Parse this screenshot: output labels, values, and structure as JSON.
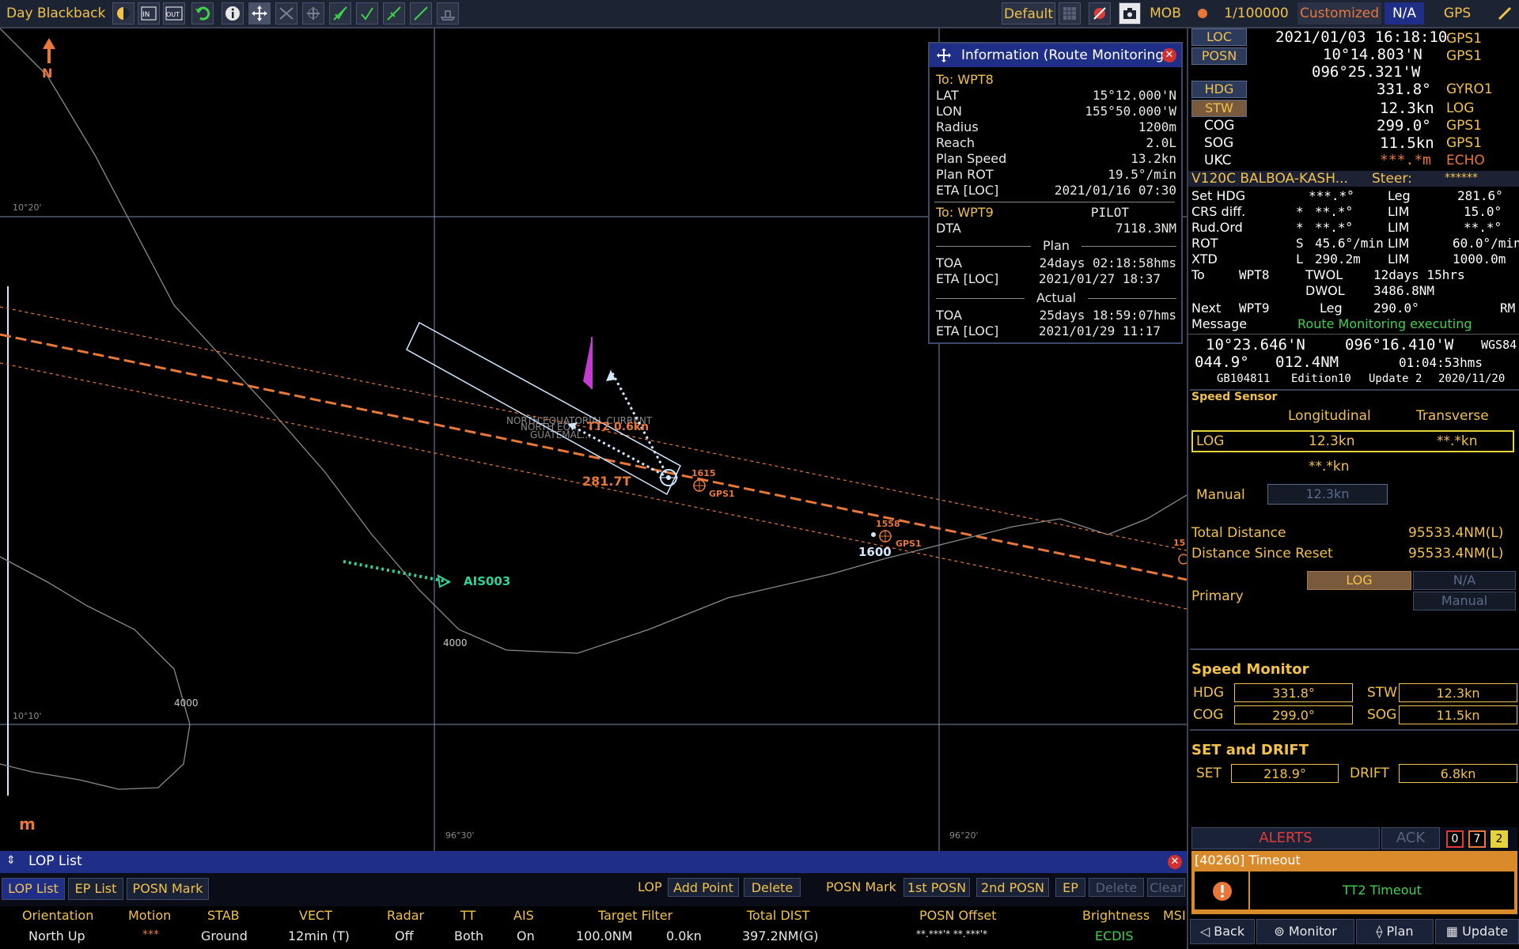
{
  "toolbar": {
    "mode": "Day Blackback",
    "default": "Default",
    "mob": "MOB",
    "scale": "1/100000",
    "customized": "Customized",
    "na": "N/A",
    "gps": "GPS"
  },
  "chart": {
    "north": "N",
    "lat_label_1": "10°20'",
    "lat_label_2": "10°10'",
    "lon_label_1": "96°30'",
    "lon_label_2": "96°20'",
    "depth_1": "4000",
    "depth_2": "4000",
    "current_text_1": "NORTH EQUATORIAL CURRENT",
    "current_text_2": "NORTH EQ...",
    "current_text_3": "GUATEMAL...",
    "tt_label": "TT2 0.6kn",
    "course_label": "281.7T",
    "time_1615": "1615",
    "gps1_a": "GPS1",
    "time_1558": "1558",
    "time_1600": "1600",
    "gps1_b": "GPS1",
    "edge_label": "15",
    "ais_label": "AIS003",
    "unit_m": "m",
    "colors": {
      "route": "#e8773a",
      "ais": "#2fd19a",
      "ownship": "#cfe8ff",
      "flag": "#c43bd4"
    }
  },
  "info": {
    "title": "Information (Route Monitoring)",
    "to_wpt8": "To: WPT8",
    "lat_label": "LAT",
    "lat": "15°12.000'N",
    "lon_label": "LON",
    "lon": "155°50.000'W",
    "radius_label": "Radius",
    "radius": "1200m",
    "reach_label": "Reach",
    "reach": "2.0L",
    "plan_speed_label": "Plan Speed",
    "plan_speed": "13.2kn",
    "plan_rot_label": "Plan ROT",
    "plan_rot": "19.5°/min",
    "eta_label": "ETA [LOC]",
    "eta": "2021/01/16 07:30",
    "to_wpt9": "To: WPT9",
    "pilot": "PILOT",
    "dta_label": "DTA",
    "dta": "7118.3NM",
    "plan_header": "Plan",
    "toa_label": "TOA",
    "toa_plan": "24days 02:18:58hms",
    "eta2_label": "ETA [LOC]",
    "eta_plan": "2021/01/27 18:37",
    "actual_header": "Actual",
    "toa2_label": "TOA",
    "toa_actual": "25days 18:59:07hms",
    "eta3_label": "ETA [LOC]",
    "eta_actual": "2021/01/29 11:17"
  },
  "nav": {
    "loc": "LOC",
    "datetime": "2021/01/03 16:18:10",
    "loc_src": "GPS1",
    "posn": "POSN",
    "lat": "10°14.803'N",
    "posn_src": "GPS1",
    "lon": "096°25.321'W",
    "hdg": "HDG",
    "hdg_val": "331.8°",
    "hdg_src": "GYRO1",
    "stw": "STW",
    "stw_val": "12.3kn",
    "stw_src": "LOG",
    "cog": "COG",
    "cog_val": "299.0°",
    "cog_src": "GPS1",
    "sog": "SOG",
    "sog_val": "11.5kn",
    "sog_src": "GPS1",
    "ukc": "UKC",
    "ukc_val": "***.*m",
    "ukc_src": "ECHO"
  },
  "route": {
    "name": "V120C BALBOA-KASH...",
    "steer_label": "Steer:",
    "steer": "******",
    "set_hdg_label": "Set HDG",
    "set_hdg": "***.*°",
    "leg_label": "Leg",
    "leg": "281.6°",
    "crs_label": "CRS diff.",
    "crs_flag": "*",
    "crs": "**.*°",
    "lim1_label": "LIM",
    "lim1": "15.0°",
    "rud_label": "Rud.Ord",
    "rud_flag": "*",
    "rud": "**.*°",
    "lim2_label": "LIM",
    "lim2": "**.*°",
    "rot_label": "ROT",
    "rot_flag": "S",
    "rot": "45.6°/min",
    "lim3_label": "LIM",
    "lim3": "60.0°/min",
    "xtd_label": "XTD",
    "xtd_flag": "L",
    "xtd": "290.2m",
    "lim4_label": "LIM",
    "lim4": "1000.0m",
    "to_label": "To",
    "to_wpt": "WPT8",
    "twol_label": "TWOL",
    "twol": "12days 15hrs",
    "dwol_label": "DWOL",
    "dwol": "3486.8NM",
    "next_label": "Next",
    "next_wpt": "WPT9",
    "leg2_label": "Leg",
    "leg2": "290.0°",
    "rm": "RM",
    "message_label": "Message",
    "message": "Route Monitoring executing",
    "cursor_lat": "10°23.646'N",
    "cursor_lon": "096°16.410'W",
    "datum": "WGS84",
    "brg": "044.9°",
    "rng": "012.4NM",
    "ttg": "01:04:53hms",
    "cell": "GB104811",
    "edition": "Edition10",
    "update": "Update 2",
    "upd_date": "2020/11/20"
  },
  "speed": {
    "sensor_title": "Speed Sensor",
    "longitudinal": "Longitudinal",
    "transverse": "Transverse",
    "log_label": "LOG",
    "log_long": "12.3kn",
    "log_trans": "**.*kn",
    "other": "**.*kn",
    "manual_label": "Manual",
    "manual_val": "12.3kn",
    "total_label": "Total Distance",
    "total": "95533.4NM(L)",
    "since_label": "Distance Since Reset",
    "since": "95533.4NM(L)",
    "primary_label": "Primary",
    "primary_log": "LOG",
    "primary_na": "N/A",
    "primary_manual": "Manual"
  },
  "monitor": {
    "title": "Speed Monitor",
    "hdg_label": "HDG",
    "hdg": "331.8°",
    "stw_label": "STW",
    "stw": "12.3kn",
    "cog_label": "COG",
    "cog": "299.0°",
    "sog_label": "SOG",
    "sog": "11.5kn"
  },
  "setdrift": {
    "title": "SET and DRIFT",
    "set_label": "SET",
    "set": "218.9°",
    "drift_label": "DRIFT",
    "drift": "6.8kn"
  },
  "alerts": {
    "title": "ALERTS",
    "ack": "ACK",
    "c0": "0",
    "c7": "7",
    "c2": "2",
    "item": "[40260] Timeout",
    "detail": "TT2 Timeout"
  },
  "bottom_nav": {
    "back": "Back",
    "monitor": "Monitor",
    "plan": "Plan",
    "update": "Update"
  },
  "lop": {
    "title": "LOP List",
    "tab_lop": "LOP List",
    "tab_ep": "EP List",
    "tab_posn": "POSN Mark",
    "lop_label": "LOP",
    "add_point": "Add Point",
    "delete": "Delete",
    "posn_mark_label": "POSN Mark",
    "first_posn": "1st POSN",
    "second_posn": "2nd POSN",
    "ep": "EP",
    "delete2": "Delete",
    "clear": "Clear",
    "status_headers": [
      "Orientation",
      "Motion",
      "STAB",
      "VECT",
      "Radar",
      "TT",
      "AIS",
      "Target Filter",
      "",
      "Total DIST",
      "POSN Offset",
      "Brightness",
      "MSI"
    ],
    "status_values": [
      "North Up",
      "***",
      "Ground",
      "12min (T)",
      "Off",
      "Both",
      "On",
      "100.0NM",
      "0.0kn",
      "397.2NM(G)",
      "**.***'*  **.***'*",
      "ECDIS",
      ""
    ]
  }
}
